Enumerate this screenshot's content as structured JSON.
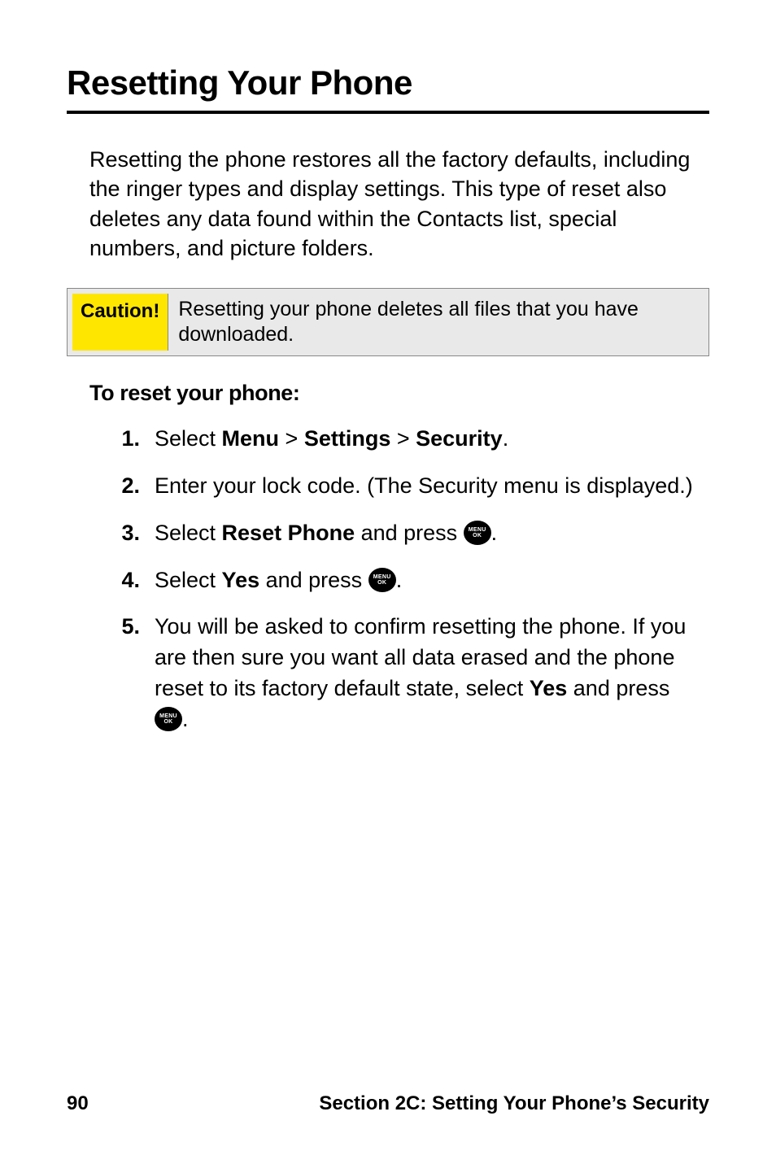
{
  "title": "Resetting Your Phone",
  "intro": "Resetting the phone restores all the factory defaults, including the ringer types and display settings. This type of reset also deletes any data found within the Contacts list, special numbers, and picture folders.",
  "caution": {
    "label": "Caution!",
    "text": "Resetting your phone deletes all files that you have downloaded."
  },
  "subhead": "To reset your phone:",
  "menu_button": {
    "line1": "MENU",
    "line2": "OK"
  },
  "steps": {
    "s1": {
      "num": "1.",
      "pre": "Select ",
      "menu": "Menu",
      "gt1": " > ",
      "settings": "Settings",
      "gt2": " > ",
      "security": "Security",
      "post": "."
    },
    "s2": {
      "num": "2.",
      "text": "Enter your lock code. (The Security menu is displayed.)"
    },
    "s3": {
      "num": "3.",
      "pre": "Select ",
      "reset": "Reset Phone",
      "mid": " and press ",
      "post": "."
    },
    "s4": {
      "num": "4.",
      "pre": "Select ",
      "yes": "Yes",
      "mid": " and press ",
      "post": "."
    },
    "s5": {
      "num": "5.",
      "pre": "You will be asked to confirm resetting the phone. If you are then sure you want all data erased and the phone reset to its factory default state, select ",
      "yes": "Yes",
      "mid": " and press ",
      "post": "."
    }
  },
  "footer": {
    "page": "90",
    "section": "Section 2C: Setting Your Phone’s Security"
  }
}
